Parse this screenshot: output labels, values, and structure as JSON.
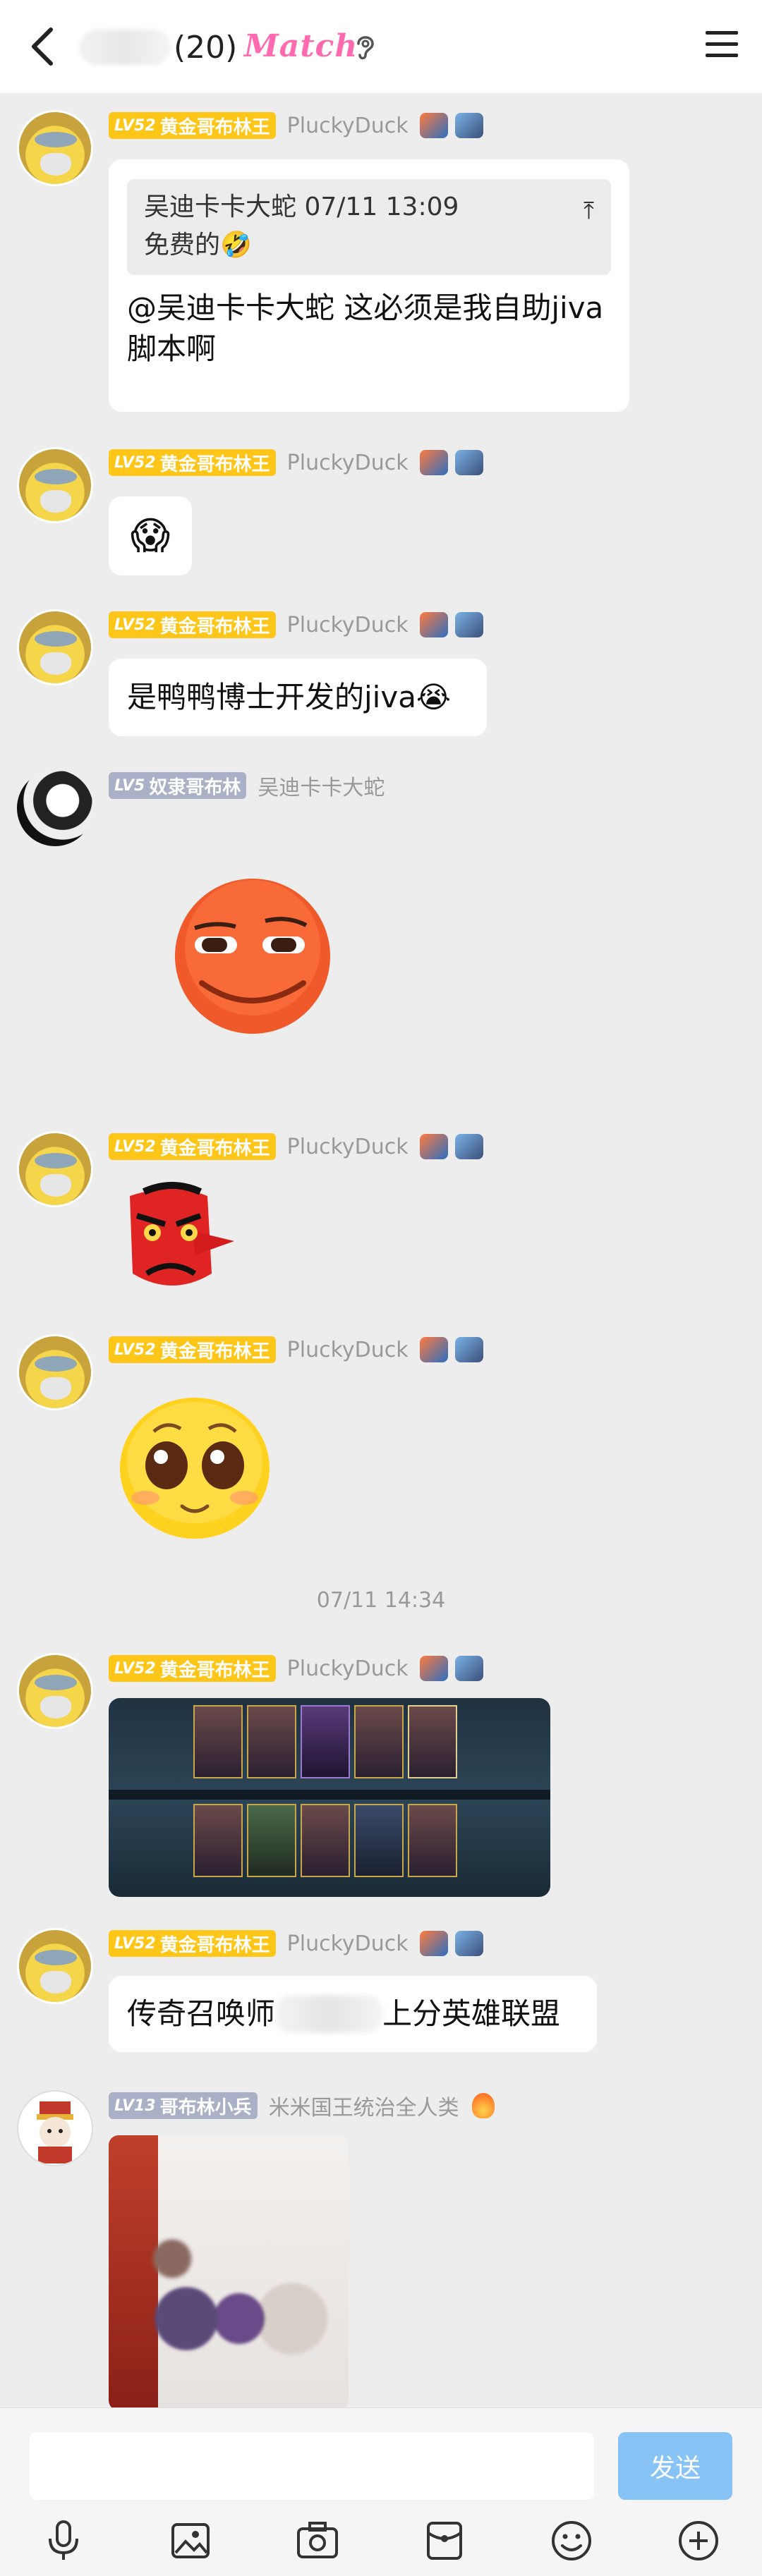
{
  "header": {
    "count": "(20)",
    "match_label": "Match"
  },
  "messages": [
    {
      "level": "LV52",
      "title": "黄金哥布林王",
      "user": "PluckyDuck",
      "quote_header": "吴迪卡卡大蛇 07/11 13:09",
      "quote_text": "免费的🤣",
      "text": "@吴迪卡卡大蛇 这必须是我自助jiva脚本啊"
    },
    {
      "level": "LV52",
      "title": "黄金哥布林王",
      "user": "PluckyDuck",
      "text": "😱"
    },
    {
      "level": "LV52",
      "title": "黄金哥布林王",
      "user": "PluckyDuck",
      "text": "是鸭鸭博士开发的jiva😭"
    },
    {
      "level": "LV5",
      "title": "奴隶哥布林",
      "user": "吴迪卡卡大蛇",
      "sticker": "smirk-face"
    },
    {
      "level": "LV52",
      "title": "黄金哥布林王",
      "user": "PluckyDuck",
      "sticker": "tengu-mask"
    },
    {
      "level": "LV52",
      "title": "黄金哥布林王",
      "user": "PluckyDuck",
      "sticker": "pleading-face"
    },
    {
      "level": "LV52",
      "title": "黄金哥布林王",
      "user": "PluckyDuck",
      "image": "game-screenshot"
    },
    {
      "level": "LV52",
      "title": "黄金哥布林王",
      "user": "PluckyDuck",
      "text_a": "传奇召唤师",
      "text_b": "上分英雄联盟"
    },
    {
      "level": "LV13",
      "title": "哥布林小兵",
      "user": "米米国王统治全人类",
      "image": "photo"
    }
  ],
  "timestamp": "07/11 14:34",
  "composer": {
    "send_label": "发送",
    "input_value": ""
  },
  "colors": {
    "gold_badge": "#ffc61a",
    "grey_badge": "#aab0c6",
    "send_button": "#87c3f5",
    "match": "#ff6ab0"
  }
}
